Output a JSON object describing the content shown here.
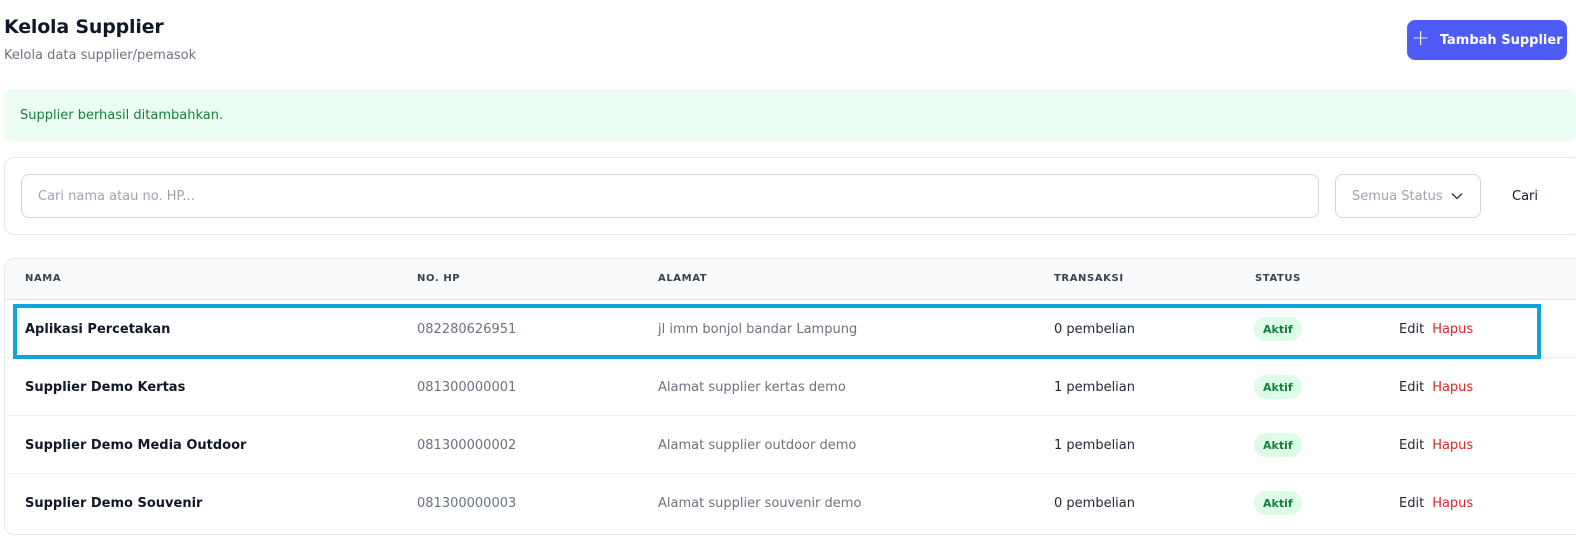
{
  "header": {
    "title": "Kelola Supplier",
    "subtitle": "Kelola data supplier/pemasok",
    "add_button_label": "Tambah Supplier",
    "add_button_icon": "plus-icon"
  },
  "alert": {
    "message": "Supplier berhasil ditambahkan."
  },
  "filters": {
    "search_placeholder": "Cari nama atau no. HP...",
    "search_value": "",
    "status_selected": "Semua Status",
    "search_button_label": "Cari"
  },
  "table": {
    "headers": {
      "name": "NAMA",
      "phone": "NO. HP",
      "address": "ALAMAT",
      "transactions": "TRANSAKSI",
      "status": "STATUS"
    },
    "rows": [
      {
        "name": "Aplikasi Percetakan",
        "phone": "082280626951",
        "address": "jl imm bonjol bandar Lampung",
        "transactions": "0 pembelian",
        "status": "Aktif",
        "edit": "Edit",
        "delete": "Hapus"
      },
      {
        "name": "Supplier Demo Kertas",
        "phone": "081300000001",
        "address": "Alamat supplier kertas demo",
        "transactions": "1 pembelian",
        "status": "Aktif",
        "edit": "Edit",
        "delete": "Hapus"
      },
      {
        "name": "Supplier Demo Media Outdoor",
        "phone": "081300000002",
        "address": "Alamat supplier outdoor demo",
        "transactions": "1 pembelian",
        "status": "Aktif",
        "edit": "Edit",
        "delete": "Hapus"
      },
      {
        "name": "Supplier Demo Souvenir",
        "phone": "081300000003",
        "address": "Alamat supplier souvenir demo",
        "transactions": "0 pembelian",
        "status": "Aktif",
        "edit": "Edit",
        "delete": "Hapus"
      }
    ]
  },
  "colors": {
    "primary": "#4f5bf7",
    "success_bg": "#ecfdf3",
    "success_text": "#15803d",
    "danger": "#dc2626",
    "highlight": "#0ea5dc"
  }
}
